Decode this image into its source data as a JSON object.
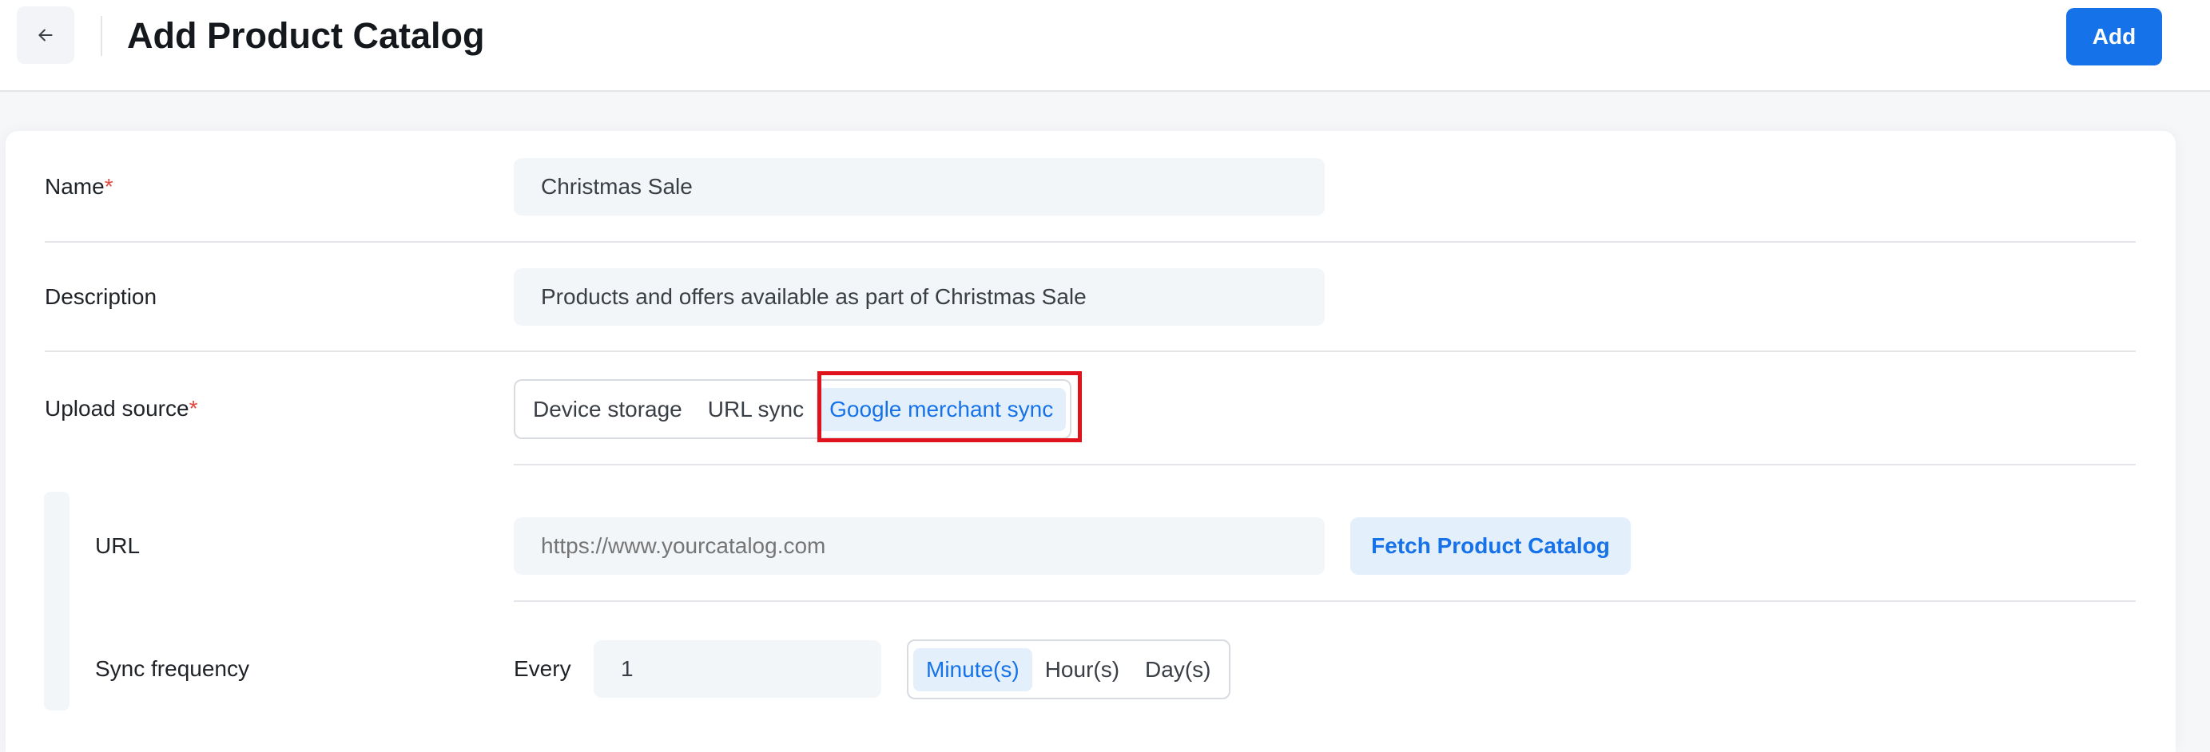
{
  "header": {
    "title": "Add Product Catalog",
    "add_label": "Add"
  },
  "form": {
    "name": {
      "label": "Name",
      "required_mark": "*",
      "value": "Christmas Sale"
    },
    "description": {
      "label": "Description",
      "value": "Products and offers available as part of Christmas Sale"
    },
    "upload_source": {
      "label": "Upload source",
      "required_mark": "*",
      "options": [
        "Device storage",
        "URL sync",
        "Google merchant sync"
      ],
      "selected": "Google merchant sync"
    },
    "url": {
      "label": "URL",
      "placeholder": "https://www.yourcatalog.com",
      "value": ""
    },
    "fetch_label": "Fetch Product Catalog",
    "sync_frequency": {
      "label": "Sync frequency",
      "prefix": "Every",
      "value": "1",
      "units": [
        "Minute(s)",
        "Hour(s)",
        "Day(s)"
      ],
      "selected": "Minute(s)"
    }
  },
  "colors": {
    "accent": "#1672e8",
    "highlight": "#e0121b",
    "required": "#e5483b"
  }
}
